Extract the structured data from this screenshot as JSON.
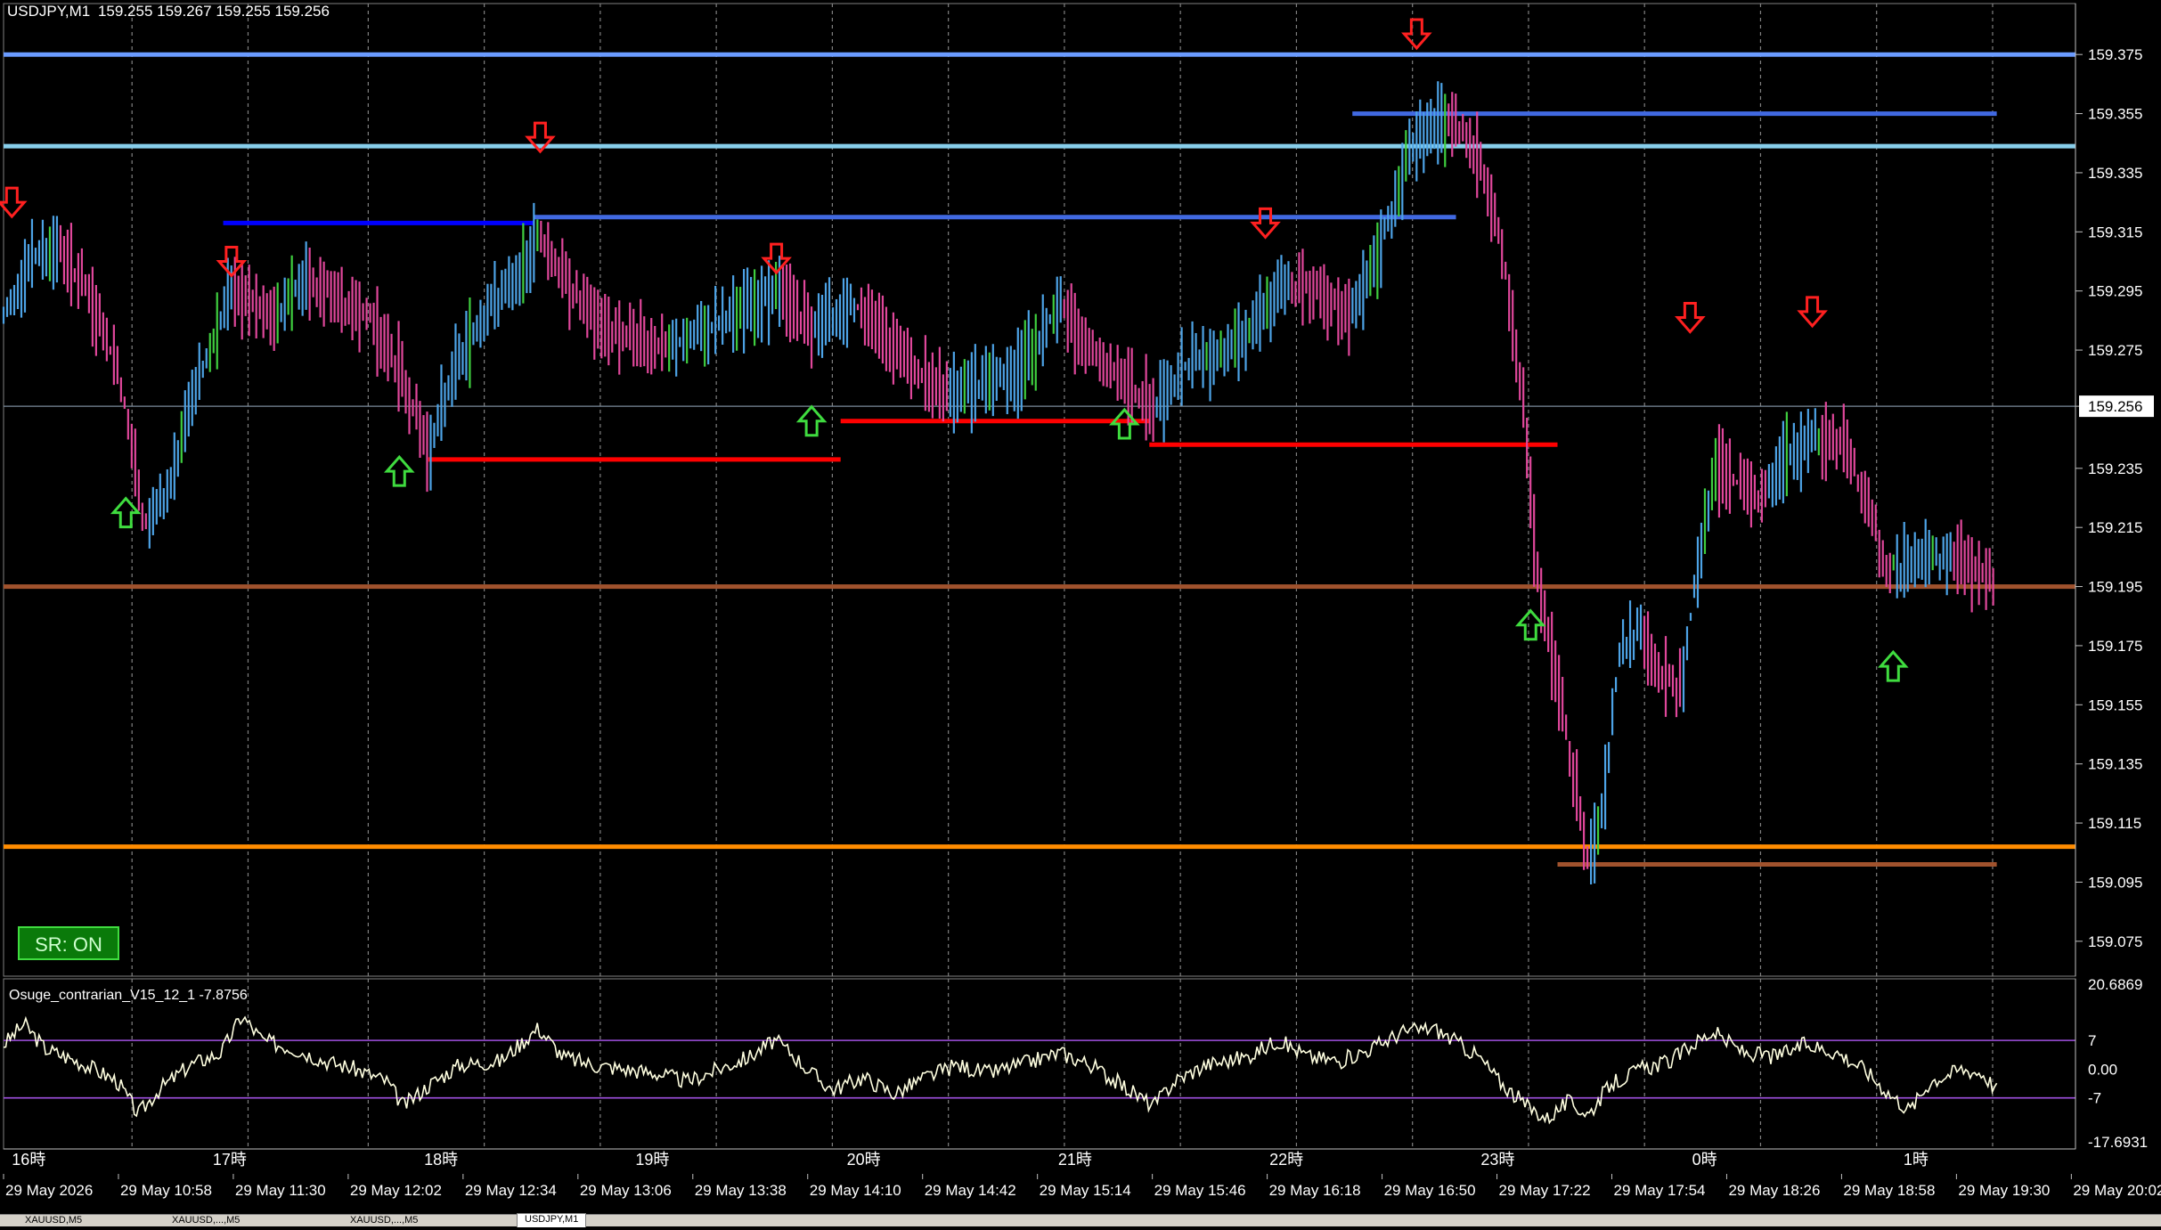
{
  "header": {
    "symbol": "USDJPY,M1",
    "ohlc": "159.255 159.267 159.255 159.256"
  },
  "indicator": {
    "label": "Osuge_contrarian_V15_12_1 -7.8756",
    "axis_labels": [
      "20.6869",
      "7",
      "0.00",
      "-7",
      "-17.6931"
    ],
    "upper_level": 7,
    "lower_level": -7,
    "max": 20.6869,
    "min": -17.6931
  },
  "sr_button": "SR: ON",
  "current_price_label": "159.256",
  "hour_labels": [
    "16時",
    "17時",
    "18時",
    "19時",
    "20時",
    "21時",
    "22時",
    "23時",
    "0時",
    "1時"
  ],
  "date_labels": [
    "29 May 2026",
    "29 May 10:58",
    "29 May 11:30",
    "29 May 12:02",
    "29 May 12:34",
    "29 May 13:06",
    "29 May 13:38",
    "29 May 14:10",
    "29 May 14:42",
    "29 May 15:14",
    "29 May 15:46",
    "29 May 16:18",
    "29 May 16:50",
    "29 May 17:22",
    "29 May 17:54",
    "29 May 18:26",
    "29 May 18:58",
    "29 May 19:30",
    "29 May 20:02"
  ],
  "tabs": [
    "XAUUSD,M5",
    "XAUUSD,...,M5",
    "XAUUSD,...,M5",
    "USDJPY,M1"
  ],
  "colors": {
    "bull": "#4da3e6",
    "bear": "#e0479b",
    "neutral": "#3fcf3f",
    "resistance": "#4169e1",
    "support": "#ff0000",
    "grid": "#808080",
    "osc": "#ffffe0",
    "level": "#a050e0"
  },
  "chart_data": {
    "type": "candlestick",
    "title": "USDJPY,M1",
    "ylim": [
      159.065,
      159.385
    ],
    "y_ticks": [
      "159.375",
      "159.355",
      "159.335",
      "159.315",
      "159.295",
      "159.275",
      "159.256",
      "159.235",
      "159.215",
      "159.195",
      "159.175",
      "159.155",
      "159.135",
      "159.115",
      "159.095",
      "159.075"
    ],
    "current_price": 159.256,
    "horizontal_lines": [
      {
        "price": 159.375,
        "color": "#6a9bff",
        "label": "top resistance"
      },
      {
        "price": 159.344,
        "color": "#87ceeb",
        "label": "resistance"
      },
      {
        "price": 159.195,
        "color": "#a0522d",
        "label": "mid support"
      },
      {
        "price": 159.107,
        "color": "#ff8c00",
        "label": "support"
      }
    ],
    "segments": [
      {
        "x0": 0.106,
        "x1": 0.256,
        "price": 159.318,
        "color": "#0000ff"
      },
      {
        "x0": 0.256,
        "x1": 0.701,
        "price": 159.32,
        "color": "#4169e1"
      },
      {
        "x0": 0.651,
        "x1": 0.962,
        "price": 159.355,
        "color": "#4169e1"
      },
      {
        "x0": 0.205,
        "x1": 0.404,
        "price": 159.238,
        "color": "#ff0000"
      },
      {
        "x0": 0.404,
        "x1": 0.553,
        "price": 159.251,
        "color": "#ff0000"
      },
      {
        "x0": 0.553,
        "x1": 0.75,
        "price": 159.243,
        "color": "#ff0000"
      },
      {
        "x0": 0.75,
        "x1": 0.962,
        "price": 159.101,
        "color": "#a0522d"
      }
    ],
    "sell_arrows": [
      {
        "x": 0.004,
        "price": 159.325
      },
      {
        "x": 0.11,
        "price": 159.305
      },
      {
        "x": 0.259,
        "price": 159.347
      },
      {
        "x": 0.373,
        "price": 159.306
      },
      {
        "x": 0.609,
        "price": 159.318
      },
      {
        "x": 0.682,
        "price": 159.382
      },
      {
        "x": 0.814,
        "price": 159.286
      },
      {
        "x": 0.873,
        "price": 159.288
      }
    ],
    "buy_arrows": [
      {
        "x": 0.059,
        "price": 159.22
      },
      {
        "x": 0.191,
        "price": 159.234
      },
      {
        "x": 0.39,
        "price": 159.251
      },
      {
        "x": 0.541,
        "price": 159.25
      },
      {
        "x": 0.737,
        "price": 159.182
      },
      {
        "x": 0.912,
        "price": 159.168
      }
    ],
    "price_path": [
      [
        0.0,
        159.285
      ],
      [
        0.012,
        159.305
      ],
      [
        0.027,
        159.31
      ],
      [
        0.04,
        159.295
      ],
      [
        0.055,
        159.27
      ],
      [
        0.068,
        159.215
      ],
      [
        0.08,
        159.23
      ],
      [
        0.094,
        159.265
      ],
      [
        0.11,
        159.295
      ],
      [
        0.13,
        159.285
      ],
      [
        0.145,
        159.3
      ],
      [
        0.16,
        159.292
      ],
      [
        0.178,
        159.285
      ],
      [
        0.193,
        159.265
      ],
      [
        0.205,
        159.24
      ],
      [
        0.218,
        159.27
      ],
      [
        0.235,
        159.29
      ],
      [
        0.25,
        159.3
      ],
      [
        0.258,
        159.315
      ],
      [
        0.27,
        159.3
      ],
      [
        0.285,
        159.285
      ],
      [
        0.3,
        159.28
      ],
      [
        0.32,
        159.275
      ],
      [
        0.34,
        159.282
      ],
      [
        0.36,
        159.29
      ],
      [
        0.375,
        159.295
      ],
      [
        0.39,
        159.282
      ],
      [
        0.41,
        159.292
      ],
      [
        0.425,
        159.28
      ],
      [
        0.44,
        159.27
      ],
      [
        0.455,
        159.26
      ],
      [
        0.47,
        159.262
      ],
      [
        0.49,
        159.268
      ],
      [
        0.51,
        159.29
      ],
      [
        0.525,
        159.275
      ],
      [
        0.54,
        159.265
      ],
      [
        0.555,
        159.255
      ],
      [
        0.57,
        159.27
      ],
      [
        0.59,
        159.275
      ],
      [
        0.605,
        159.285
      ],
      [
        0.62,
        159.298
      ],
      [
        0.635,
        159.295
      ],
      [
        0.65,
        159.285
      ],
      [
        0.665,
        159.31
      ],
      [
        0.68,
        159.345
      ],
      [
        0.695,
        159.352
      ],
      [
        0.705,
        159.35
      ],
      [
        0.715,
        159.335
      ],
      [
        0.725,
        159.3
      ],
      [
        0.733,
        159.26
      ],
      [
        0.74,
        159.2
      ],
      [
        0.748,
        159.17
      ],
      [
        0.757,
        159.135
      ],
      [
        0.765,
        159.1
      ],
      [
        0.772,
        159.12
      ],
      [
        0.78,
        159.175
      ],
      [
        0.79,
        159.18
      ],
      [
        0.8,
        159.165
      ],
      [
        0.81,
        159.16
      ],
      [
        0.818,
        159.205
      ],
      [
        0.826,
        159.235
      ],
      [
        0.838,
        159.23
      ],
      [
        0.85,
        159.225
      ],
      [
        0.862,
        159.24
      ],
      [
        0.875,
        159.245
      ],
      [
        0.888,
        159.243
      ],
      [
        0.898,
        159.225
      ],
      [
        0.91,
        159.2
      ],
      [
        0.925,
        159.205
      ],
      [
        0.94,
        159.205
      ],
      [
        0.955,
        159.2
      ],
      [
        0.962,
        159.195
      ]
    ],
    "oscillator_path": [
      [
        0.0,
        6
      ],
      [
        0.01,
        11
      ],
      [
        0.02,
        5
      ],
      [
        0.03,
        3
      ],
      [
        0.04,
        1
      ],
      [
        0.055,
        -3
      ],
      [
        0.065,
        -11
      ],
      [
        0.075,
        -5
      ],
      [
        0.09,
        1
      ],
      [
        0.105,
        4
      ],
      [
        0.115,
        13
      ],
      [
        0.125,
        7
      ],
      [
        0.14,
        5
      ],
      [
        0.155,
        2
      ],
      [
        0.17,
        0
      ],
      [
        0.185,
        -3
      ],
      [
        0.193,
        -9
      ],
      [
        0.205,
        -4
      ],
      [
        0.22,
        1
      ],
      [
        0.24,
        2
      ],
      [
        0.258,
        10
      ],
      [
        0.27,
        3
      ],
      [
        0.285,
        1
      ],
      [
        0.3,
        0
      ],
      [
        0.315,
        -1
      ],
      [
        0.33,
        -3
      ],
      [
        0.345,
        0
      ],
      [
        0.36,
        3
      ],
      [
        0.372,
        7
      ],
      [
        0.38,
        4
      ],
      [
        0.39,
        -1
      ],
      [
        0.4,
        -5
      ],
      [
        0.415,
        -2
      ],
      [
        0.43,
        -6
      ],
      [
        0.445,
        -2
      ],
      [
        0.46,
        1
      ],
      [
        0.475,
        -1
      ],
      [
        0.49,
        1
      ],
      [
        0.51,
        4
      ],
      [
        0.525,
        1
      ],
      [
        0.54,
        -4
      ],
      [
        0.555,
        -9
      ],
      [
        0.565,
        -3
      ],
      [
        0.58,
        1
      ],
      [
        0.6,
        3
      ],
      [
        0.615,
        7
      ],
      [
        0.63,
        3
      ],
      [
        0.645,
        2
      ],
      [
        0.66,
        5
      ],
      [
        0.675,
        9
      ],
      [
        0.69,
        10
      ],
      [
        0.7,
        7
      ],
      [
        0.712,
        3
      ],
      [
        0.722,
        -3
      ],
      [
        0.735,
        -9
      ],
      [
        0.745,
        -12
      ],
      [
        0.755,
        -8
      ],
      [
        0.765,
        -11
      ],
      [
        0.775,
        -4
      ],
      [
        0.79,
        0
      ],
      [
        0.805,
        2
      ],
      [
        0.815,
        6
      ],
      [
        0.825,
        9
      ],
      [
        0.84,
        4
      ],
      [
        0.855,
        3
      ],
      [
        0.87,
        6
      ],
      [
        0.885,
        4
      ],
      [
        0.898,
        0
      ],
      [
        0.91,
        -6
      ],
      [
        0.92,
        -10
      ],
      [
        0.93,
        -3
      ],
      [
        0.945,
        0
      ],
      [
        0.955,
        -1
      ],
      [
        0.962,
        -5
      ]
    ]
  }
}
